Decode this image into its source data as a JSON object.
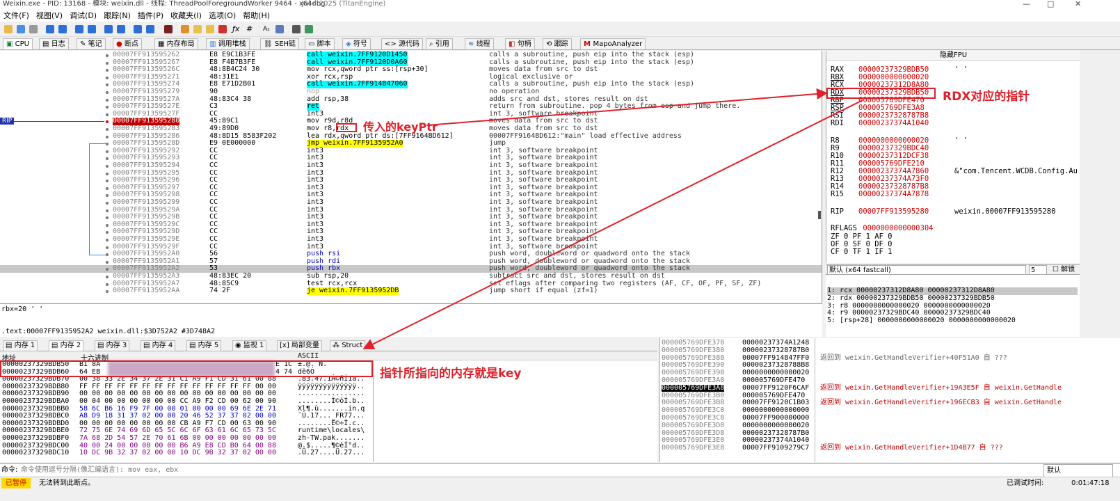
{
  "window": {
    "title": "Weixin.exe - PID: 13168 - 模块: weixin.dll - 线程: ThreadPoolForegroundWorker 9464 - x64dbg",
    "date": "Jul 4 2025 (TitanEngine)",
    "btn_min": "—",
    "btn_max": "□",
    "btn_close": "✕"
  },
  "menu": [
    "文件(F)",
    "视图(V)",
    "调试(D)",
    "跟踪(N)",
    "插件(P)",
    "收藏夹(I)",
    "选项(O)",
    "帮助(H)"
  ],
  "tabs": [
    "CPU",
    "日志",
    "笔记",
    "断点",
    "内存布局",
    "调用堆栈",
    "SEH链",
    "脚本",
    "符号",
    "源代码",
    "引用",
    "线程",
    "句柄",
    "跟踪",
    "MapoAnalyzer"
  ],
  "rip_label": "RIP",
  "disasm": [
    {
      "addr": "00007FF913595262",
      "bytes": "E8 E9C1B3FE",
      "ins": "call weixin.7FF9120D1450",
      "cls": "kw-call",
      "cmt": "calls a subroutine, push eip into the stack (esp)"
    },
    {
      "addr": "00007FF913595267",
      "bytes": "E8 F4B7B3FE",
      "ins": "call weixin.7FF9120D0A60",
      "cls": "kw-call",
      "cmt": "calls a subroutine, push eip into the stack (esp)"
    },
    {
      "addr": "00007FF91359526C",
      "bytes": "48:8B4C24 30",
      "ins": "mov rcx,qword ptr ss:[rsp+30]",
      "cls": "",
      "cmt": "moves data from src to dst"
    },
    {
      "addr": "00007FF913595271",
      "bytes": "48:31E1",
      "ins": "xor rcx,rsp",
      "cls": "",
      "cmt": "logical exclusive or"
    },
    {
      "addr": "00007FF913595274",
      "bytes": "E8 E71D2B01",
      "ins": "call weixin.7FF914847060",
      "cls": "kw-call",
      "cmt": "calls a subroutine, push eip into the stack (esp)"
    },
    {
      "addr": "00007FF913595279",
      "bytes": "90",
      "ins": "nop",
      "cls": "kw-nop",
      "cmt": "no operation"
    },
    {
      "addr": "00007FF91359527A",
      "bytes": "48:83C4 38",
      "ins": "add rsp,38",
      "cls": "",
      "cmt": "adds src and dst, stores result on dst"
    },
    {
      "addr": "00007FF91359527E",
      "bytes": "C3",
      "ins": "ret",
      "cls": "kw-ret",
      "cmt": "return from subroutine. pop 4 bytes from esp and jump there."
    },
    {
      "addr": "00007FF91359527F",
      "bytes": "CC",
      "ins": "int3",
      "cls": "",
      "cmt": "int 3, software breakpoint"
    },
    {
      "addr": "00007FF913595280",
      "bytes": "45:89C1",
      "ins": "mov r9d,r8d",
      "cls": "",
      "cmt": "moves data from src to dst",
      "rip": true
    },
    {
      "addr": "00007FF913595283",
      "bytes": "49:89D0",
      "ins": "mov r8,rdx",
      "cls": "",
      "cmt": "moves data from src to dst"
    },
    {
      "addr": "00007FF913595286",
      "bytes": "48:8D15 8583F202",
      "ins": "lea rdx,qword ptr ds:[7FF9164BD612]",
      "cls": "",
      "cmt": "00007FF9164BD612:\"main\" load effective address"
    },
    {
      "addr": "00007FF91359528D",
      "bytes": "E9 0E000000",
      "ins": "jmp weixin.7FF9135952A0",
      "cls": "kw-jmp",
      "cmt": "jump"
    },
    {
      "addr": "00007FF913595292",
      "bytes": "CC",
      "ins": "int3",
      "cls": "",
      "cmt": "int 3, software breakpoint"
    },
    {
      "addr": "00007FF913595293",
      "bytes": "CC",
      "ins": "int3",
      "cls": "",
      "cmt": "int 3, software breakpoint"
    },
    {
      "addr": "00007FF913595294",
      "bytes": "CC",
      "ins": "int3",
      "cls": "",
      "cmt": "int 3, software breakpoint"
    },
    {
      "addr": "00007FF913595295",
      "bytes": "CC",
      "ins": "int3",
      "cls": "",
      "cmt": "int 3, software breakpoint"
    },
    {
      "addr": "00007FF913595296",
      "bytes": "CC",
      "ins": "int3",
      "cls": "",
      "cmt": "int 3, software breakpoint"
    },
    {
      "addr": "00007FF913595297",
      "bytes": "CC",
      "ins": "int3",
      "cls": "",
      "cmt": "int 3, software breakpoint"
    },
    {
      "addr": "00007FF913595298",
      "bytes": "CC",
      "ins": "int3",
      "cls": "",
      "cmt": "int 3, software breakpoint"
    },
    {
      "addr": "00007FF913595299",
      "bytes": "CC",
      "ins": "int3",
      "cls": "",
      "cmt": "int 3, software breakpoint"
    },
    {
      "addr": "00007FF91359529A",
      "bytes": "CC",
      "ins": "int3",
      "cls": "",
      "cmt": "int 3, software breakpoint"
    },
    {
      "addr": "00007FF91359529B",
      "bytes": "CC",
      "ins": "int3",
      "cls": "",
      "cmt": "int 3, software breakpoint"
    },
    {
      "addr": "00007FF91359529C",
      "bytes": "CC",
      "ins": "int3",
      "cls": "",
      "cmt": "int 3, software breakpoint"
    },
    {
      "addr": "00007FF91359529D",
      "bytes": "CC",
      "ins": "int3",
      "cls": "",
      "cmt": "int 3, software breakpoint"
    },
    {
      "addr": "00007FF91359529E",
      "bytes": "CC",
      "ins": "int3",
      "cls": "",
      "cmt": "int 3, software breakpoint"
    },
    {
      "addr": "00007FF91359529F",
      "bytes": "CC",
      "ins": "int3",
      "cls": "",
      "cmt": "int 3, software breakpoint"
    },
    {
      "addr": "00007FF9135952A0",
      "bytes": "56",
      "ins": "push rsi",
      "cls": "kw-push",
      "cmt": "push word, doubleword or quadword onto the stack"
    },
    {
      "addr": "00007FF9135952A1",
      "bytes": "57",
      "ins": "push rdi",
      "cls": "kw-push",
      "cmt": "push word, doubleword or quadword onto the stack"
    },
    {
      "addr": "00007FF9135952A2",
      "bytes": "53",
      "ins": "push rbx",
      "cls": "kw-push",
      "cmt": "push word, doubleword or quadword onto the stack",
      "sel": true
    },
    {
      "addr": "00007FF9135952A3",
      "bytes": "48:83EC 20",
      "ins": "sub rsp,20",
      "cls": "",
      "cmt": "subtract src and dst, stores result on dst"
    },
    {
      "addr": "00007FF9135952A7",
      "bytes": "48:85C9",
      "ins": "test rcx,rcx",
      "cls": "",
      "cmt": "set eflags after comparing two registers (AF, CF, OF, PF, SF, ZF)"
    },
    {
      "addr": "00007FF9135952AA",
      "bytes": "74 2F",
      "ins": "je weixin.7FF9135952DB",
      "cls": "kw-jmp",
      "cmt": "jump short if equal (zf=1)"
    }
  ],
  "regs_header": "隐藏FPU",
  "regs": [
    {
      "n": "RAX",
      "v": "00000237329BDB50",
      "c": "' '"
    },
    {
      "n": "RBX",
      "v": "0000000000000020",
      "c": ""
    },
    {
      "n": "RCX",
      "v": "00000237312D8A80",
      "c": ""
    },
    {
      "n": "RDX",
      "v": "00000237329BDB50",
      "c": ""
    },
    {
      "n": "RBP",
      "v": "000005769DFE470",
      "c": ""
    },
    {
      "n": "RSP",
      "v": "000005769DFE3A8",
      "c": ""
    },
    {
      "n": "RSI",
      "v": "00000237328787B8",
      "c": ""
    },
    {
      "n": "RDI",
      "v": "00000237374A1040",
      "c": ""
    },
    {
      "n": "R8",
      "v": "0000000000000020",
      "c": "' '"
    },
    {
      "n": "R9",
      "v": "00000237329BDC40",
      "c": ""
    },
    {
      "n": "R10",
      "v": "00000237312DCF38",
      "c": ""
    },
    {
      "n": "R11",
      "v": "000005769DFE210",
      "c": ""
    },
    {
      "n": "R12",
      "v": "00000237374A7860",
      "c": "&\"com.Tencent.WCDB.Config.Au"
    },
    {
      "n": "R13",
      "v": "00000237374A73F0",
      "c": ""
    },
    {
      "n": "R14",
      "v": "00000237328787B8",
      "c": ""
    },
    {
      "n": "R15",
      "v": "00000237374A7878",
      "c": ""
    },
    {
      "n": "RIP",
      "v": "00007FF913595280",
      "c": "weixin.00007FF913595280"
    }
  ],
  "rflags": {
    "label": "RFLAGS",
    "value": "0000000000000304",
    "line1": "ZF 0  PF 1  AF 0",
    "line2": "OF 0  SF 0  DF 0",
    "line3": "CF 0  TF 1  IF 1"
  },
  "callconv": {
    "label": "默认 (x64 fastcall)",
    "count": "5",
    "unlock": "解锁"
  },
  "args": [
    "1: rcx 00000237312D8A80 00000237312D8A80",
    "2: rdx 00000237329BDB50 00000237329BDB50",
    "3: r8 0000000000000020 0000000000000020",
    "4: r9 00000237329BDC40 00000237329BDC40",
    "5: [rsp+28] 0000000000000020 0000000000000020"
  ],
  "info": {
    "line1": "rbx=20 ' '",
    "line2": ".text:00007FF9135952A2 weixin.dll:$3D752A2 #3D748A2"
  },
  "dumptabs": [
    "内存 1",
    "内存 2",
    "内存 3",
    "内存 4",
    "内存 5",
    "监视 1",
    "局部变量",
    "Struct"
  ],
  "dump_headers": {
    "addr": "地址",
    "hex": "十六进制",
    "ascii": "ASCII"
  },
  "dump": [
    {
      "a": "00000237329BDB50",
      "h": "B1 8A",
      "h2": "E 1C",
      "s": "±.@.    N."
    },
    {
      "a": "00000237329BDB60",
      "h": "64 EB",
      "h2": "4 74",
      "s": "dë6Ó"
    },
    {
      "a": "00000237329BDB70",
      "h": "00 38 33 2E 34 37 2E 31 C1 A9 F1 CD 31 61 00 88",
      "s": ".83.47.1Á©ñÍ1a.."
    },
    {
      "a": "00000237329BDB80",
      "h": "FF FF FF FF FF FF FF FF FF FF FF FF FF FF 00 00",
      "s": "ÿÿÿÿÿÿÿÿÿÿÿÿÿÿ.."
    },
    {
      "a": "00000237329BDB90",
      "h": "00 00 00 00 00 00 00 00 00 00 00 00 00 00 00 00",
      "s": "................"
    },
    {
      "a": "00000237329BDBA0",
      "h": "00 04 00 00 00 00 00 00 CC A9 F2 CD 00 62 00 90",
      "s": "........Ì©òÍ.b.."
    },
    {
      "a": "00000237329BDBB0",
      "h": "58 6C B6 16 F9 7F 00 00 01 00 00 00 69 6E 2E 71",
      "s": "Xl¶.ù.......in.q"
    },
    {
      "a": "00000237329BDBC0",
      "h": "A8 D9 18 31 37 02 00 00 20 46 52 37 37 02 00 00",
      "s": "¨Ù.17... FR77..."
    },
    {
      "a": "00000237329BDBD0",
      "h": "00 00 00 00 00 00 00 00 CB A9 F7 CD 00 63 00 90",
      "s": "........Ë©÷Í.c.."
    },
    {
      "a": "00000237329BDBE0",
      "h": "72 75 6E 74 69 6D 65 5C 6C 6F 63 61 6C 65 73 5C",
      "s": "runtime\\locales\\"
    },
    {
      "a": "00000237329BDBF0",
      "h": "7A 68 2D 54 57 2E 70 61 6B 00 00 00 00 00 00 00",
      "s": "zh-TW.pak......."
    },
    {
      "a": "00000237329BDC00",
      "h": "40 00 24 00 00 08 00 00 B6 A9 E8 CD B0 64 00 88",
      "s": "@.$.....¶©èÍ°d.."
    },
    {
      "a": "00000237329BDC10",
      "h": "10 DC 9B 32 37 02 00 00 10 DC 9B 32 37 02 00 00",
      "s": ".Ü.27....Ü.27..."
    }
  ],
  "stack": [
    {
      "a": "000005769DFE378",
      "v": "00000237374A1248",
      "c": ""
    },
    {
      "a": "000005769DFE380",
      "v": "00000237328787B0",
      "c": ""
    },
    {
      "a": "000005769DFE388",
      "v": "00007FF914847FF0",
      "c": "返回到 weixin.GetHandleVerifier+40F51A0 自 ???"
    },
    {
      "a": "000005769DFE390",
      "v": "00000237328788B8",
      "c": ""
    },
    {
      "a": "000005769DFE398",
      "v": "0000000000000020",
      "c": ""
    },
    {
      "a": "000005769DFE3A0",
      "v": "000005769DFE470",
      "c": ""
    },
    {
      "a": "000005769DFE3A8",
      "v": "00007FF9120F6CAF",
      "c": "返回到 weixin.GetHandleVerifier+19A3E5F 自 weixin.GetHandle",
      "sel": true
    },
    {
      "a": "000005769DFE3B0",
      "v": "000005769DFE470",
      "c": ""
    },
    {
      "a": "000005769DFE3B8",
      "v": "00007FF9120C1B03",
      "c": "返回到 weixin.GetHandleVerifier+196ECB3 自 weixin.GetHandle"
    },
    {
      "a": "000005769DFE3C0",
      "v": "0000000000000000",
      "c": ""
    },
    {
      "a": "000005769DFE3C8",
      "v": "00007FF900000000",
      "c": ""
    },
    {
      "a": "000005769DFE3D0",
      "v": "0000000000000020",
      "c": ""
    },
    {
      "a": "000005769DFE3D8",
      "v": "00000237328787B0",
      "c": ""
    },
    {
      "a": "000005769DFE3E0",
      "v": "00000237374A1040",
      "c": ""
    },
    {
      "a": "000005769DFE3E8",
      "v": "00007FF9109279C7",
      "c": "返回到 weixin.GetHandleVerifier+1D4B77 自 ???"
    }
  ],
  "cmd": {
    "label": "命令:",
    "placeholder": "命令使用逗号分隔(像汇编语言): mov eax, ebx",
    "right": "默认"
  },
  "status": {
    "state": "已暂停",
    "msg": "无法转到此断点。",
    "time_label": "已调试时间:",
    "time": "0:01:47:18"
  },
  "annotations": {
    "keyptr": "传入的keyPtr",
    "rdx": "RDX对应的指针",
    "mem": "指针所指向的内存就是key"
  },
  "colors": {
    "accent": "#e0202a",
    "call": "#00ffff",
    "jmp": "#ffff00",
    "reg_value": "#d00000"
  }
}
